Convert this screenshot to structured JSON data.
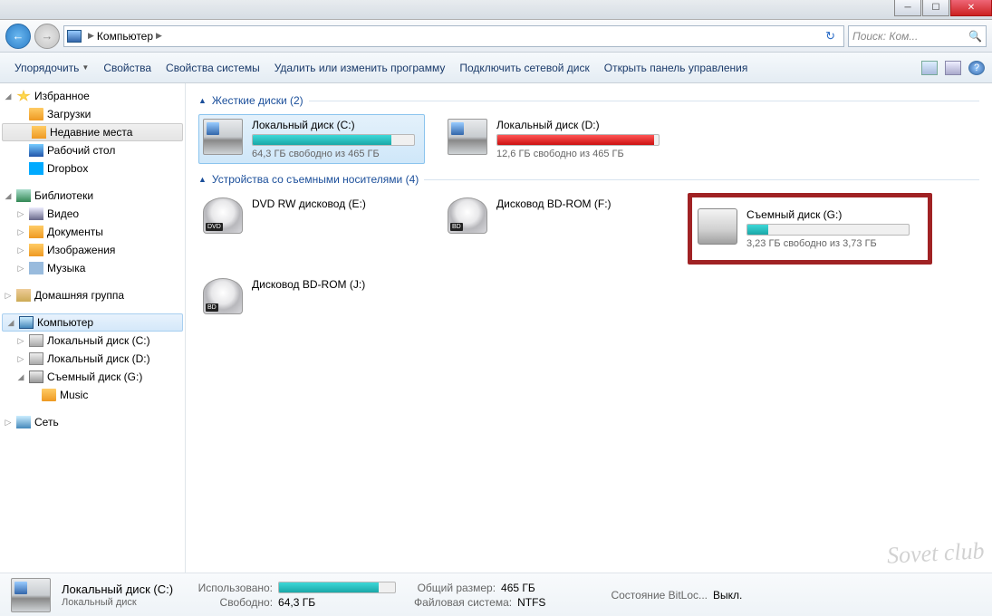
{
  "navbar": {
    "breadcrumb": "Компьютер",
    "search_placeholder": "Поиск: Ком..."
  },
  "toolbar": {
    "organize": "Упорядочить",
    "properties": "Свойства",
    "sys_properties": "Свойства системы",
    "uninstall": "Удалить или изменить программу",
    "map_drive": "Подключить сетевой диск",
    "control_panel": "Открыть панель управления"
  },
  "sidebar": {
    "favorites": "Избранное",
    "downloads": "Загрузки",
    "recent": "Недавние места",
    "desktop": "Рабочий стол",
    "dropbox": "Dropbox",
    "libraries": "Библиотеки",
    "videos": "Видео",
    "documents": "Документы",
    "pictures": "Изображения",
    "music": "Музыка",
    "homegroup": "Домашняя группа",
    "computer": "Компьютер",
    "drive_c": "Локальный диск (C:)",
    "drive_d": "Локальный диск (D:)",
    "drive_g": "Съемный диск (G:)",
    "music_folder": "Music",
    "network": "Сеть"
  },
  "content": {
    "hdd_header": "Жесткие диски (2)",
    "removable_header": "Устройства со съемными носителями (4)",
    "drive_c": {
      "name": "Локальный диск (C:)",
      "free": "64,3 ГБ свободно из 465 ГБ",
      "percent": 86
    },
    "drive_d": {
      "name": "Локальный диск (D:)",
      "free": "12,6 ГБ свободно из 465 ГБ",
      "percent": 97
    },
    "dvd_e": {
      "name": "DVD RW дисковод (E:)",
      "badge": "DVD"
    },
    "bd_f": {
      "name": "Дисковод BD-ROM (F:)",
      "badge": "BD"
    },
    "usb_g": {
      "name": "Съемный диск (G:)",
      "free": "3,23 ГБ свободно из 3,73 ГБ",
      "percent": 13
    },
    "bd_j": {
      "name": "Дисковод BD-ROM (J:)",
      "badge": "BD"
    }
  },
  "details": {
    "name": "Локальный диск (C:)",
    "type": "Локальный диск",
    "used_label": "Использовано:",
    "free_label": "Свободно:",
    "free_value": "64,3 ГБ",
    "total_label": "Общий размер:",
    "total_value": "465 ГБ",
    "fs_label": "Файловая система:",
    "fs_value": "NTFS",
    "bitlocker_label": "Состояние BitLoc...",
    "bitlocker_value": "Выкл.",
    "bar_percent": 86
  },
  "watermark": "Sovet club"
}
